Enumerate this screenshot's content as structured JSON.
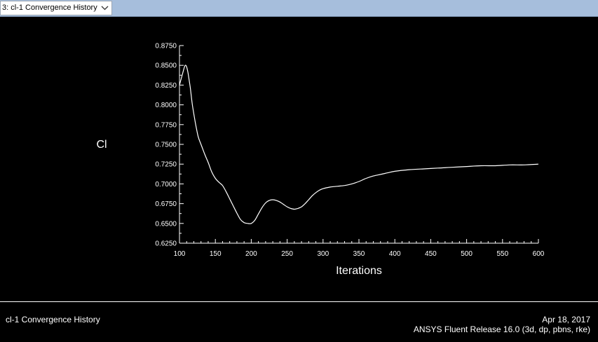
{
  "window_select": {
    "label": "3: cl-1 Convergence History",
    "icon": "chevron-down-icon"
  },
  "footer": {
    "left_title": "cl-1 Convergence History",
    "date": "Apr 18, 2017",
    "release": "ANSYS Fluent Release 16.0 (3d, dp, pbns, rke)"
  },
  "colors": {
    "background": "#000000",
    "foreground": "#ffffff",
    "topbar": "#a6bedc"
  },
  "chart_data": {
    "type": "line",
    "title": "",
    "xlabel": "Iterations",
    "ylabel": "Cl",
    "xlim": [
      100,
      600
    ],
    "ylim": [
      0.625,
      0.875
    ],
    "xticks": [
      100,
      150,
      200,
      250,
      300,
      350,
      400,
      450,
      500,
      550,
      600
    ],
    "xtick_labels": [
      "100",
      "150",
      "200",
      "250",
      "300",
      "350",
      "400",
      "450",
      "500",
      "550",
      "600"
    ],
    "yticks": [
      0.625,
      0.65,
      0.675,
      0.7,
      0.725,
      0.75,
      0.775,
      0.8,
      0.825,
      0.85,
      0.875
    ],
    "ytick_labels": [
      "0.6250",
      "0.6500",
      "0.6750",
      "0.7000",
      "0.7250",
      "0.7500",
      "0.7750",
      "0.8000",
      "0.8250",
      "0.8500",
      "0.8750"
    ],
    "grid": false,
    "legend": "none",
    "series": [
      {
        "x": [
          100,
          103,
          106,
          108,
          110,
          112,
          115,
          118,
          122,
          126,
          130,
          135,
          140,
          145,
          150,
          155,
          160,
          165,
          170,
          175,
          180,
          185,
          190,
          195,
          200,
          205,
          210,
          215,
          220,
          225,
          230,
          235,
          240,
          245,
          250,
          255,
          260,
          265,
          270,
          275,
          280,
          285,
          290,
          295,
          300,
          310,
          320,
          330,
          340,
          350,
          360,
          370,
          380,
          390,
          400,
          420,
          440,
          460,
          480,
          500,
          520,
          540,
          560,
          580,
          600
        ],
        "y": [
          0.825,
          0.835,
          0.845,
          0.85,
          0.848,
          0.84,
          0.822,
          0.8,
          0.778,
          0.76,
          0.75,
          0.738,
          0.727,
          0.715,
          0.707,
          0.702,
          0.698,
          0.69,
          0.681,
          0.672,
          0.663,
          0.655,
          0.651,
          0.65,
          0.65,
          0.654,
          0.662,
          0.67,
          0.676,
          0.679,
          0.68,
          0.679,
          0.677,
          0.674,
          0.671,
          0.669,
          0.668,
          0.669,
          0.671,
          0.675,
          0.68,
          0.685,
          0.689,
          0.692,
          0.694,
          0.696,
          0.697,
          0.698,
          0.7,
          0.703,
          0.707,
          0.71,
          0.712,
          0.714,
          0.716,
          0.718,
          0.719,
          0.72,
          0.721,
          0.722,
          0.723,
          0.723,
          0.724,
          0.724,
          0.725
        ]
      }
    ]
  }
}
